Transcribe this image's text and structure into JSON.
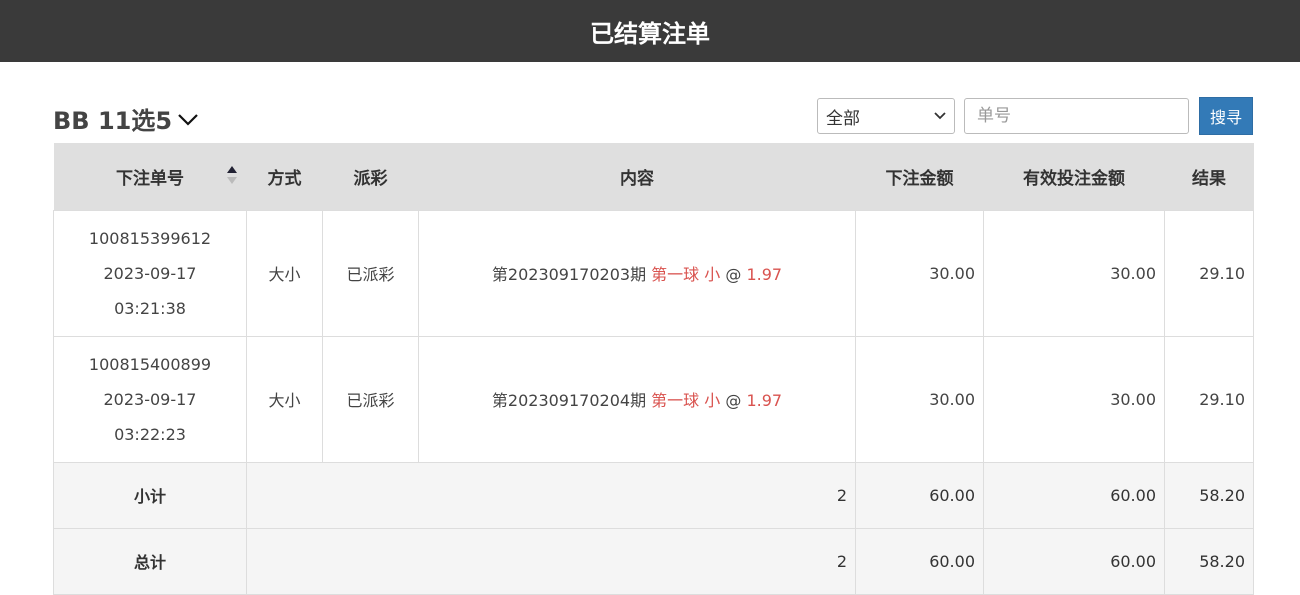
{
  "header": {
    "title": "已结算注单"
  },
  "toolbar": {
    "game_name": "BB 11选5",
    "filter_selected": "全部",
    "order_placeholder": "单号",
    "search_label": "搜寻"
  },
  "table": {
    "columns": [
      "下注单号",
      "方式",
      "派彩",
      "内容",
      "下注金额",
      "有效投注金额",
      "结果"
    ],
    "rows": [
      {
        "order_no": "100815399612",
        "date": "2023-09-17",
        "time": "03:21:38",
        "method": "大小",
        "payout": "已派彩",
        "content_period": "第202309170203期",
        "content_pick": "第一球 小",
        "content_at": "@",
        "content_odds": "1.97",
        "bet_amount": "30.00",
        "valid_amount": "30.00",
        "result": "29.10"
      },
      {
        "order_no": "100815400899",
        "date": "2023-09-17",
        "time": "03:22:23",
        "method": "大小",
        "payout": "已派彩",
        "content_period": "第202309170204期",
        "content_pick": "第一球 小",
        "content_at": "@",
        "content_odds": "1.97",
        "bet_amount": "30.00",
        "valid_amount": "30.00",
        "result": "29.10"
      }
    ],
    "subtotal": {
      "label": "小计",
      "count": "2",
      "bet_amount": "60.00",
      "valid_amount": "60.00",
      "result": "58.20"
    },
    "total": {
      "label": "总计",
      "count": "2",
      "bet_amount": "60.00",
      "valid_amount": "60.00",
      "result": "58.20"
    }
  },
  "colors": {
    "topbar": "#3a3a3a",
    "accent": "#337ab7",
    "highlight": "#d9534f"
  }
}
